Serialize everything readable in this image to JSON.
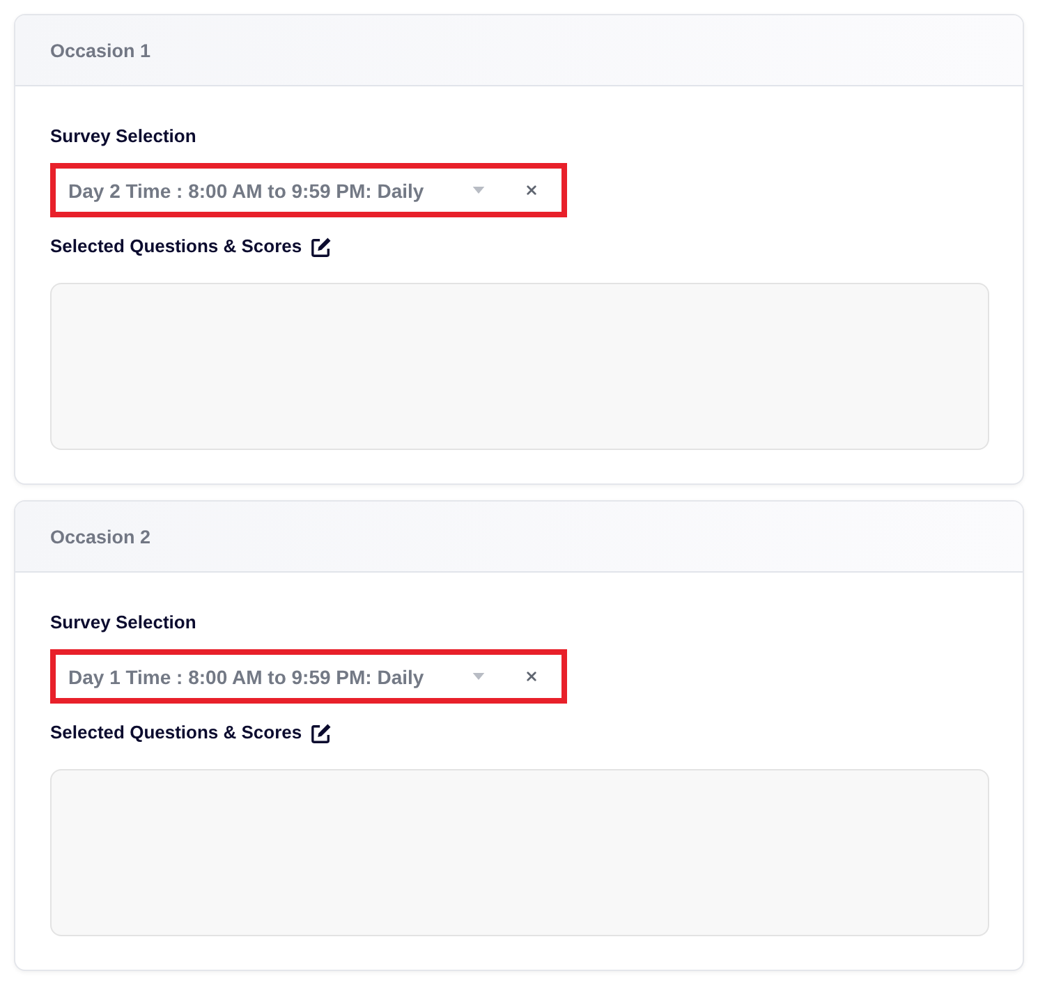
{
  "occasions": [
    {
      "title": "Occasion 1",
      "survey_label": "Survey Selection",
      "survey_select": {
        "value": "Day 2 Time : 8:00 AM to 9:59 PM: Daily",
        "highlighted": true
      },
      "questions_label": "Selected Questions & Scores"
    },
    {
      "title": "Occasion 2",
      "survey_label": "Survey Selection",
      "survey_select": {
        "value": "Day 1 Time : 8:00 AM to 9:59 PM: Daily",
        "highlighted": true
      },
      "questions_label": "Selected Questions & Scores"
    }
  ]
}
